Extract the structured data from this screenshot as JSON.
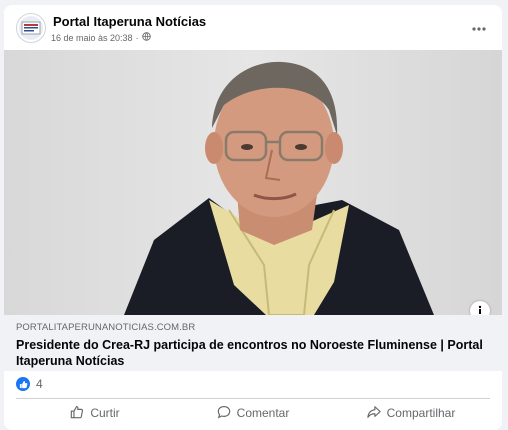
{
  "post": {
    "page_name": "Portal Itaperuna Notícias",
    "timestamp": "16 de maio às 20:38",
    "separator": "·",
    "more_icon": "more-horizontal-icon",
    "privacy_icon": "globe-icon"
  },
  "link_preview": {
    "domain": "PORTALITAPERUNANOTICIAS.COM.BR",
    "title": "Presidente do Crea-RJ participa de encontros no Noroeste Fluminense | Portal Itaperuna Notícias",
    "info_icon": "info-icon"
  },
  "reactions": {
    "icon": "like-icon",
    "count": "4"
  },
  "actions": {
    "like_label": "Curtir",
    "comment_label": "Comentar",
    "share_label": "Compartilhar"
  },
  "colors": {
    "brand_blue": "#1877f2",
    "text_primary": "#050505",
    "text_secondary": "#65676b",
    "background": "#f0f2f5"
  }
}
